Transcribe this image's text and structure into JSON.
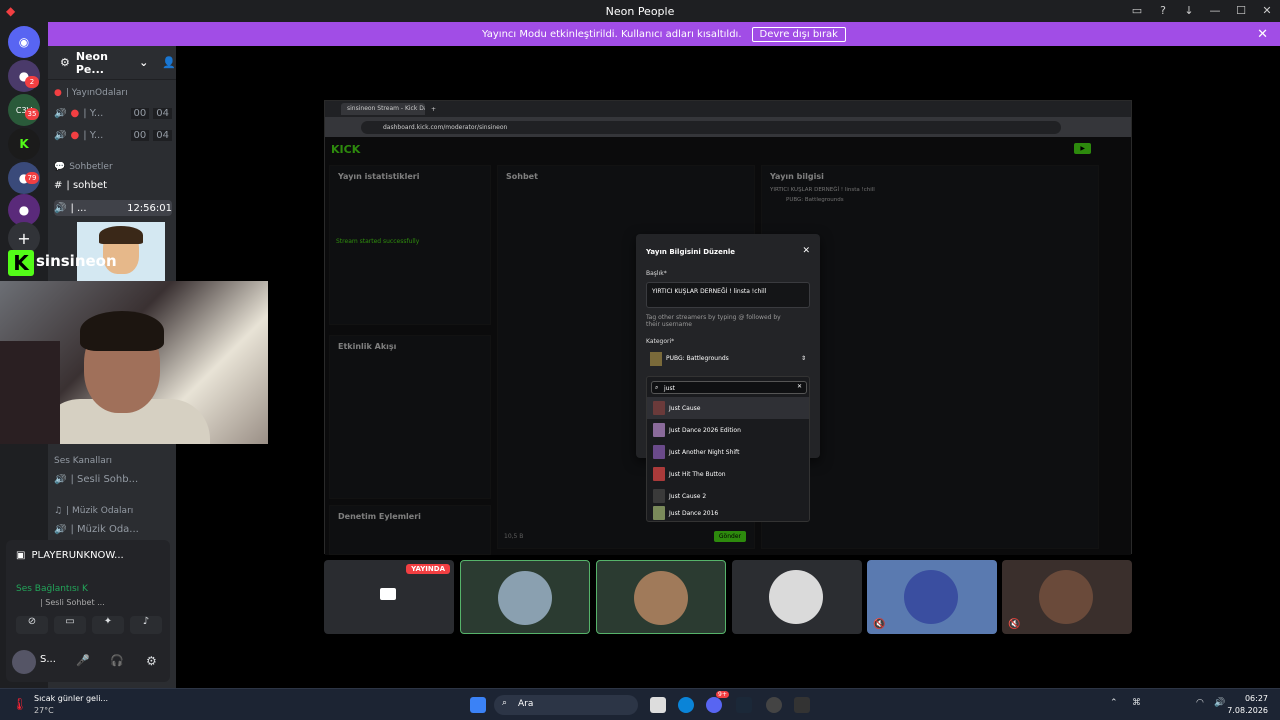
{
  "window": {
    "title": "Neon People"
  },
  "banner": {
    "message": "Yayıncı Modu etkinleştirildi. Kullanıcı adları kısaltıldı.",
    "button": "Devre dışı bırak"
  },
  "guild_badges": [
    "2",
    "35",
    "79"
  ],
  "server": {
    "name": "Neon Pe..."
  },
  "channels": {
    "cat_stream": "| YayınOdaları",
    "stream_rooms": [
      {
        "label": "| Y...",
        "count_a": "00",
        "count_b": "04"
      },
      {
        "label": "| Y...",
        "count_a": "00",
        "count_b": "04"
      }
    ],
    "cat_chat": "Sohbetler",
    "text_channel": "| sohbet",
    "active_voice": {
      "label": "| ...",
      "timer": "12:56:01"
    },
    "cat_voice": "Ses Kanalları",
    "voice_channel": "| Sesli Sohb...",
    "cat_music": "| Müzik Odaları",
    "music_channel": "| Müzik Oda..."
  },
  "streamer": {
    "name": "sinsineon"
  },
  "voice_panel": {
    "activity": "PLAYERUNKNOW...",
    "connection": "Ses Bağlantısı K",
    "sub": "| Sesli Sohbet ...",
    "user": "S..."
  },
  "browser": {
    "tab": "sinsineon Stream - Kick Dashbo",
    "url": "dashboard.kick.com/moderator/sinsineon"
  },
  "kick": {
    "stats_title": "Yayın istatistikleri",
    "chat_title": "Sohbet",
    "info_title": "Yayın bilgisi",
    "activity_title": "Etkinlik Akışı",
    "moderation_title": "Denetim Eylemleri",
    "stream_info_title": "YIRTICI KUŞLAR DERNEĞİ ! linsta !chill",
    "game": "PUBG: Battlegrounds",
    "send": "Gönder",
    "viewers": "10,5 B",
    "stream_started": "Stream started successfully"
  },
  "modal": {
    "title": "Yayın Bilgisini Düzenle",
    "title_label": "Başlık*",
    "title_value": "YIRTICI KUŞLAR DERNEĞİ ! linsta !chill",
    "hint": "Tag other streamers by typing @ followed by their username",
    "category_label": "Kategori*",
    "category_value": "PUBG: Battlegrounds",
    "search_value": "just",
    "options": [
      "Just Cause",
      "Just Dance 2026 Edition",
      "Just Another Night Shift",
      "Just Hit The Button",
      "Just Cause 2",
      "Just Dance 2016"
    ]
  },
  "tiles": {
    "live_badge": "YAYINDA"
  },
  "taskbar": {
    "weather_title": "Sıcak günler geli...",
    "weather_temp": "27°C",
    "search": "Ara",
    "time": "06:27",
    "date": "7.08.2026",
    "discord_badge": "9+"
  }
}
